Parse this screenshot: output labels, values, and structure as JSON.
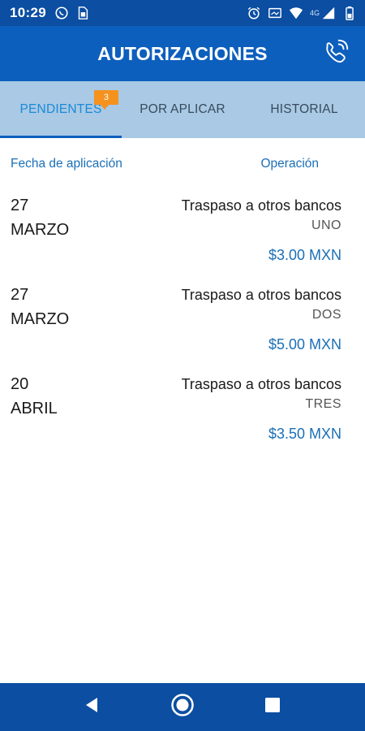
{
  "status_bar": {
    "time": "10:29",
    "left_icons": [
      "whatsapp-icon",
      "sim-icon"
    ],
    "right_icons": [
      "alarm-icon",
      "cast-icon",
      "wifi-icon",
      "signal-icon",
      "battery-icon"
    ],
    "network": "4G"
  },
  "header": {
    "title": "AUTORIZACIONES",
    "action_icon": "phone-icon"
  },
  "tabs": [
    {
      "label": "PENDIENTES",
      "badge": "3",
      "active": true
    },
    {
      "label": "POR APLICAR",
      "active": false
    },
    {
      "label": "HISTORIAL",
      "active": false
    }
  ],
  "columns": {
    "date": "Fecha de aplicación",
    "operation": "Operación"
  },
  "rows": [
    {
      "day": "27",
      "month": "MARZO",
      "operation": "Traspaso a otros bancos",
      "name": "UNO",
      "amount": "$3.00 MXN"
    },
    {
      "day": "27",
      "month": "MARZO",
      "operation": "Traspaso a otros bancos",
      "name": "DOS",
      "amount": "$5.00 MXN"
    },
    {
      "day": "20",
      "month": "ABRIL",
      "operation": "Traspaso a otros bancos",
      "name": "TRES",
      "amount": "$3.50 MXN"
    }
  ],
  "nav": {
    "icons": [
      "back-icon",
      "home-icon",
      "recents-icon"
    ]
  },
  "colors": {
    "status_bar": "#0b4ea2",
    "header": "#0d5fbd",
    "tabs": "#a9c9e4",
    "accent": "#1b6fb6",
    "badge": "#f5921e"
  }
}
